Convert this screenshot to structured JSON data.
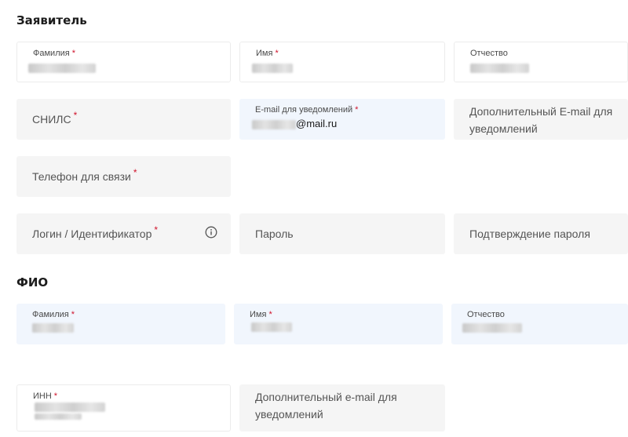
{
  "applicant": {
    "title": "Заявитель",
    "last_name_label": "Фамилия",
    "first_name_label": "Имя",
    "patronymic_label": "Отчество",
    "snils_label": "СНИЛС",
    "email_label": "E-mail для уведомлений",
    "email_value_suffix": "@mail.ru",
    "extra_email_label": "Дополнительный E-mail для уведомлений",
    "phone_label": "Телефон для связи",
    "login_label": "Логин / Идентификатор",
    "password_label": "Пароль",
    "password_confirm_label": "Подтверждение пароля"
  },
  "fio": {
    "title": "ФИО",
    "last_name_label": "Фамилия",
    "first_name_label": "Имя",
    "patronymic_label": "Отчество",
    "inn_label": "ИНН",
    "extra_email_label": "Дополнительный e-mail для уведомлений"
  },
  "required_mark": "*",
  "icons": {
    "login_info": "info-icon"
  },
  "colors": {
    "required": "#d0142c",
    "active_field": "#f1f6fd",
    "field_bg": "#f5f5f5"
  }
}
